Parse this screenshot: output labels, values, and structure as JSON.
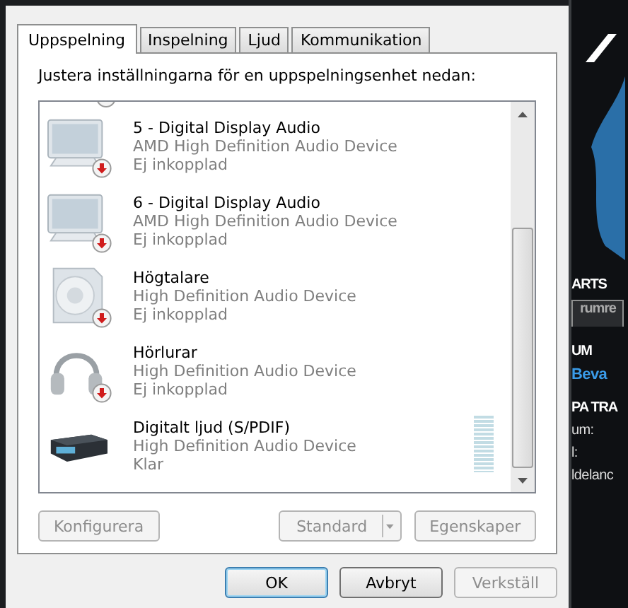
{
  "tabs": [
    {
      "label": "Uppspelning",
      "selected": true
    },
    {
      "label": "Inspelning",
      "selected": false
    },
    {
      "label": "Ljud",
      "selected": false
    },
    {
      "label": "Kommunikation",
      "selected": false
    }
  ],
  "description": "Justera inställningarna för en uppspelningsenhet nedan:",
  "devices": [
    {
      "kind": "monitor",
      "name": "5 - Digital Display Audio",
      "driver": "AMD High Definition Audio Device",
      "status": "Ej inkopplad",
      "disconnected": true
    },
    {
      "kind": "monitor",
      "name": "6 - Digital Display Audio",
      "driver": "AMD High Definition Audio Device",
      "status": "Ej inkopplad",
      "disconnected": true
    },
    {
      "kind": "speaker",
      "name": "Högtalare",
      "driver": "High Definition Audio Device",
      "status": "Ej inkopplad",
      "disconnected": true
    },
    {
      "kind": "headphones",
      "name": "Hörlurar",
      "driver": "High Definition Audio Device",
      "status": "Ej inkopplad",
      "disconnected": true
    },
    {
      "kind": "spdif",
      "name": "Digitalt ljud (S/PDIF)",
      "driver": "High Definition Audio Device",
      "status": "Klar",
      "disconnected": false,
      "level": 0
    }
  ],
  "list_buttons": [
    {
      "label": "Konfigurera",
      "disabled": true
    },
    {
      "label": "Standard",
      "disabled": true,
      "dropdown": true
    },
    {
      "label": "Egenskaper",
      "disabled": true
    }
  ],
  "dialog_buttons": [
    {
      "label": "OK",
      "disabled": false,
      "default": true
    },
    {
      "label": "Avbryt",
      "disabled": false,
      "default": false
    },
    {
      "label": "Verkställ",
      "disabled": true,
      "default": false
    }
  ],
  "background_app": {
    "texts": [
      {
        "text": "ARTS",
        "kind": "heading"
      },
      {
        "text": "rumre",
        "kind": "tab"
      },
      {
        "text": "UM",
        "kind": "heading"
      },
      {
        "text": "Beva",
        "kind": "link"
      },
      {
        "text": "PA TRA",
        "kind": "heading"
      },
      {
        "text": "um:",
        "kind": "label"
      },
      {
        "text": "l:",
        "kind": "label"
      },
      {
        "text": "ldelanc",
        "kind": "label"
      }
    ]
  }
}
